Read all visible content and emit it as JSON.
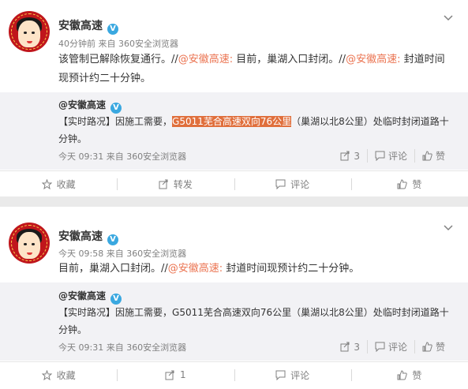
{
  "posts": [
    {
      "author": "安徽高速",
      "verified_badge": "V",
      "meta": "40分钟前 来自 360安全浏览器",
      "body": {
        "p1": "该管制已解除恢复通行。//",
        "at1": "@安徽高速:",
        "p2": " 目前，巢湖入口封闭。//",
        "at2": "@安徽高速:",
        "p3": " 封道时间现预计约二十分钟。"
      },
      "repost": {
        "author": "@安徽高速",
        "verified_badge": "V",
        "text_pre": "【实时路况】因施工需要，",
        "text_hl": "G5011芜合高速双向76公里",
        "text_post": "（巢湖以北8公里）处临时封闭道路十分钟。",
        "meta": "今天 09:31 来自 360安全浏览器",
        "forward_count": "3",
        "comment_label": "评论",
        "like_label": "赞"
      },
      "actions": {
        "fav": "收藏",
        "forward": "转发",
        "comment": "评论",
        "like": "赞"
      }
    },
    {
      "author": "安徽高速",
      "verified_badge": "V",
      "meta": "今天 09:58 来自 360安全浏览器",
      "body": {
        "p1": "目前，巢湖入口封闭。//",
        "at1": "@安徽高速:",
        "p2": " 封道时间现预计约二十分钟。"
      },
      "repost": {
        "author": "@安徽高速",
        "verified_badge": "V",
        "text_pre": "【实时路况】因施工需要，",
        "text_hl": "G5011芜合高速双向76公里",
        "text_post": "（巢湖以北8公里）处临时封闭道路十分钟。",
        "meta": "今天 09:31 来自 360安全浏览器",
        "forward_count": "3",
        "comment_label": "评论",
        "like_label": "赞"
      },
      "actions": {
        "fav": "收藏",
        "forward": "1",
        "comment": "评论",
        "like": "赞"
      }
    }
  ],
  "colors": {
    "mention": "#eb7350",
    "highlight": "#e06f3c",
    "repost_bg": "#f2f2f5",
    "avatar_red": "#c0161c"
  }
}
